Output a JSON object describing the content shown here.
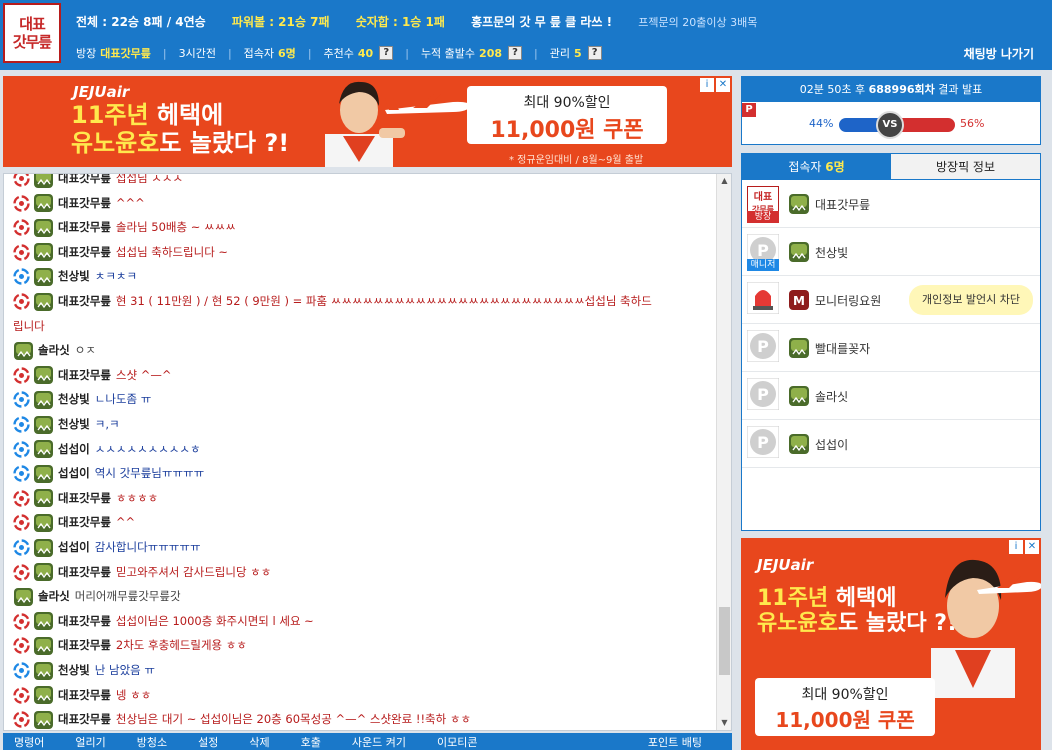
{
  "header": {
    "logo_line1": "대표",
    "logo_line2": "갓무릎",
    "stat_total": "전체 : 22승 8패 / 4연승",
    "stat_power": "파워볼 : 21승 7패",
    "stat_sum": "숫자합 : 1승 1패",
    "slogan": "홍프문의 갓 무 릎 클 라쓰 !",
    "slogan_small": "프젝문의 20출이상 3배목",
    "owner_label": "방장",
    "owner_value": "대표갓무릎",
    "duration": "3시간전",
    "viewers_label": "접속자",
    "viewers_value": "6명",
    "recommend_label": "추천수",
    "recommend_value": "40",
    "cumulative_label": "누적 출발수",
    "cumulative_value": "208",
    "manage_label": "관리",
    "manage_value": "5",
    "help_glyph": "?",
    "leave_label": "채팅방 나가기"
  },
  "ads": {
    "brand": "JEJUair",
    "headline_1": "11주년",
    "headline_2": "헤택에",
    "headline_3": "유노윤호",
    "headline_4": "도 놀랐다 ?!",
    "coupon_top": "최대 90%할인",
    "coupon_main": "11,000원 쿠폰",
    "note": "* 정규운임대비 / 8월~9월 출발",
    "adchoice_i": "i",
    "adchoice_x": "✕"
  },
  "chat": {
    "messages": [
      {
        "icon": "red",
        "nick": "대표갓무릎",
        "text": "섭섭님 ㅅㅅㅅ",
        "color": "red"
      },
      {
        "icon": "red",
        "nick": "대표갓무릎",
        "text": "^^^",
        "color": "red"
      },
      {
        "icon": "red",
        "nick": "대표갓무릎",
        "text": "솔라님 50배층 ~ ㅆㅆㅆ",
        "color": "red"
      },
      {
        "icon": "red",
        "nick": "대표갓무릎",
        "text": "섭섭님 축하드립니다 ~",
        "color": "red"
      },
      {
        "icon": "blue",
        "nick": "천상빛",
        "text": "ㅊㅋㅊㅋ",
        "color": "blue"
      },
      {
        "icon": "red",
        "nick": "대표갓무릎",
        "text": "현 31 ( 11만원 ) / 현 52 ( 9만원 ) = 파훔 ㅆㅆㅆㅆㅆㅆㅆㅆㅆㅆㅆㅆㅆㅆㅆㅆㅆㅆㅆㅆㅆㅆㅆㅆ섭섭님 축하드",
        "color": "red"
      },
      {
        "icon": "none",
        "nick": "",
        "text": "립니다",
        "color": "red"
      },
      {
        "icon": "none2",
        "nick": "솔라싯",
        "text": "ㅇㅈ",
        "color": "gray"
      },
      {
        "icon": "red",
        "nick": "대표갓무릎",
        "text": "스샷 ^—^",
        "color": "red"
      },
      {
        "icon": "blue",
        "nick": "천상빛",
        "text": "ㄴ나도좀 ㅠ",
        "color": "blue"
      },
      {
        "icon": "blue",
        "nick": "천상빛",
        "text": "ㅋ,ㅋ",
        "color": "blue"
      },
      {
        "icon": "blue",
        "nick": "섭섭이",
        "text": "ㅅㅅㅅㅅㅅㅅㅅㅅㅅㅎ",
        "color": "blue"
      },
      {
        "icon": "blue",
        "nick": "섭섭이",
        "text": "역시 갓무릎님ㅠㅠㅠㅠ",
        "color": "blue"
      },
      {
        "icon": "red",
        "nick": "대표갓무릎",
        "text": "ㅎㅎㅎㅎ",
        "color": "red"
      },
      {
        "icon": "red",
        "nick": "대표갓무릎",
        "text": "^^",
        "color": "red"
      },
      {
        "icon": "blue",
        "nick": "섭섭이",
        "text": "감사합니다ㅠㅠㅠㅠㅠ",
        "color": "blue"
      },
      {
        "icon": "red",
        "nick": "대표갓무릎",
        "text": "믿고와주셔서 감사드립니당 ㅎㅎ",
        "color": "red"
      },
      {
        "icon": "none2",
        "nick": "솔라싯",
        "text": "머리어깨무릎갓무릎갓",
        "color": "gray"
      },
      {
        "icon": "red",
        "nick": "대표갓무릎",
        "text": "섭섭이님은 1000층 화주시면되 l 세요 ~",
        "color": "red"
      },
      {
        "icon": "red",
        "nick": "대표갓무릎",
        "text": "2차도 후충헤드릴게용 ㅎㅎ",
        "color": "red"
      },
      {
        "icon": "blue",
        "nick": "천상빛",
        "text": "난 남았음 ㅠ",
        "color": "blue"
      },
      {
        "icon": "red",
        "nick": "대표갓무릎",
        "text": "넹 ㅎㅎ",
        "color": "red"
      },
      {
        "icon": "red",
        "nick": "대표갓무릎",
        "text": "천상님은 대기 ~ 섭섭이님은 20층 60목성공 ^—^ 스샷완료 !!축하 ㅎㅎ",
        "color": "red"
      }
    ]
  },
  "menubar": {
    "items": [
      "명령어",
      "얼리기",
      "방청소",
      "설정",
      "삭제",
      "호출",
      "사운드 켜기",
      "이모티콘"
    ],
    "point": "포인트 배팅"
  },
  "result": {
    "timer": "02분 50초 후",
    "round": "688996회차",
    "suffix": "결과 발표",
    "badge": "P",
    "left_pct": "44%",
    "right_pct": "56%",
    "left_ratio": 0.44,
    "vs": "VS"
  },
  "users": {
    "tab_users_label": "접속자",
    "tab_users_count": "6명",
    "tab_topic_label": "방장픽 정보",
    "list": [
      {
        "name": "대표갓무릎",
        "role": "방장",
        "avatar": "logo"
      },
      {
        "name": "천상빛",
        "role": "매니저",
        "avatar": "p"
      },
      {
        "name": "모니터링요원",
        "role": "",
        "avatar": "siren"
      },
      {
        "name": "빨대를꽂자",
        "role": "",
        "avatar": "p"
      },
      {
        "name": "솔라싯",
        "role": "",
        "avatar": "p"
      },
      {
        "name": "섭섭이",
        "role": "",
        "avatar": "p"
      }
    ],
    "tooltip": "개인정보 발언시 차단"
  },
  "colors": {
    "primary_blue": "#1a78c9",
    "accent_yellow": "#ffe94d",
    "ad_orange": "#e8471d",
    "chat_red": "#b71c1c",
    "chat_blue": "#1a3d9c"
  }
}
